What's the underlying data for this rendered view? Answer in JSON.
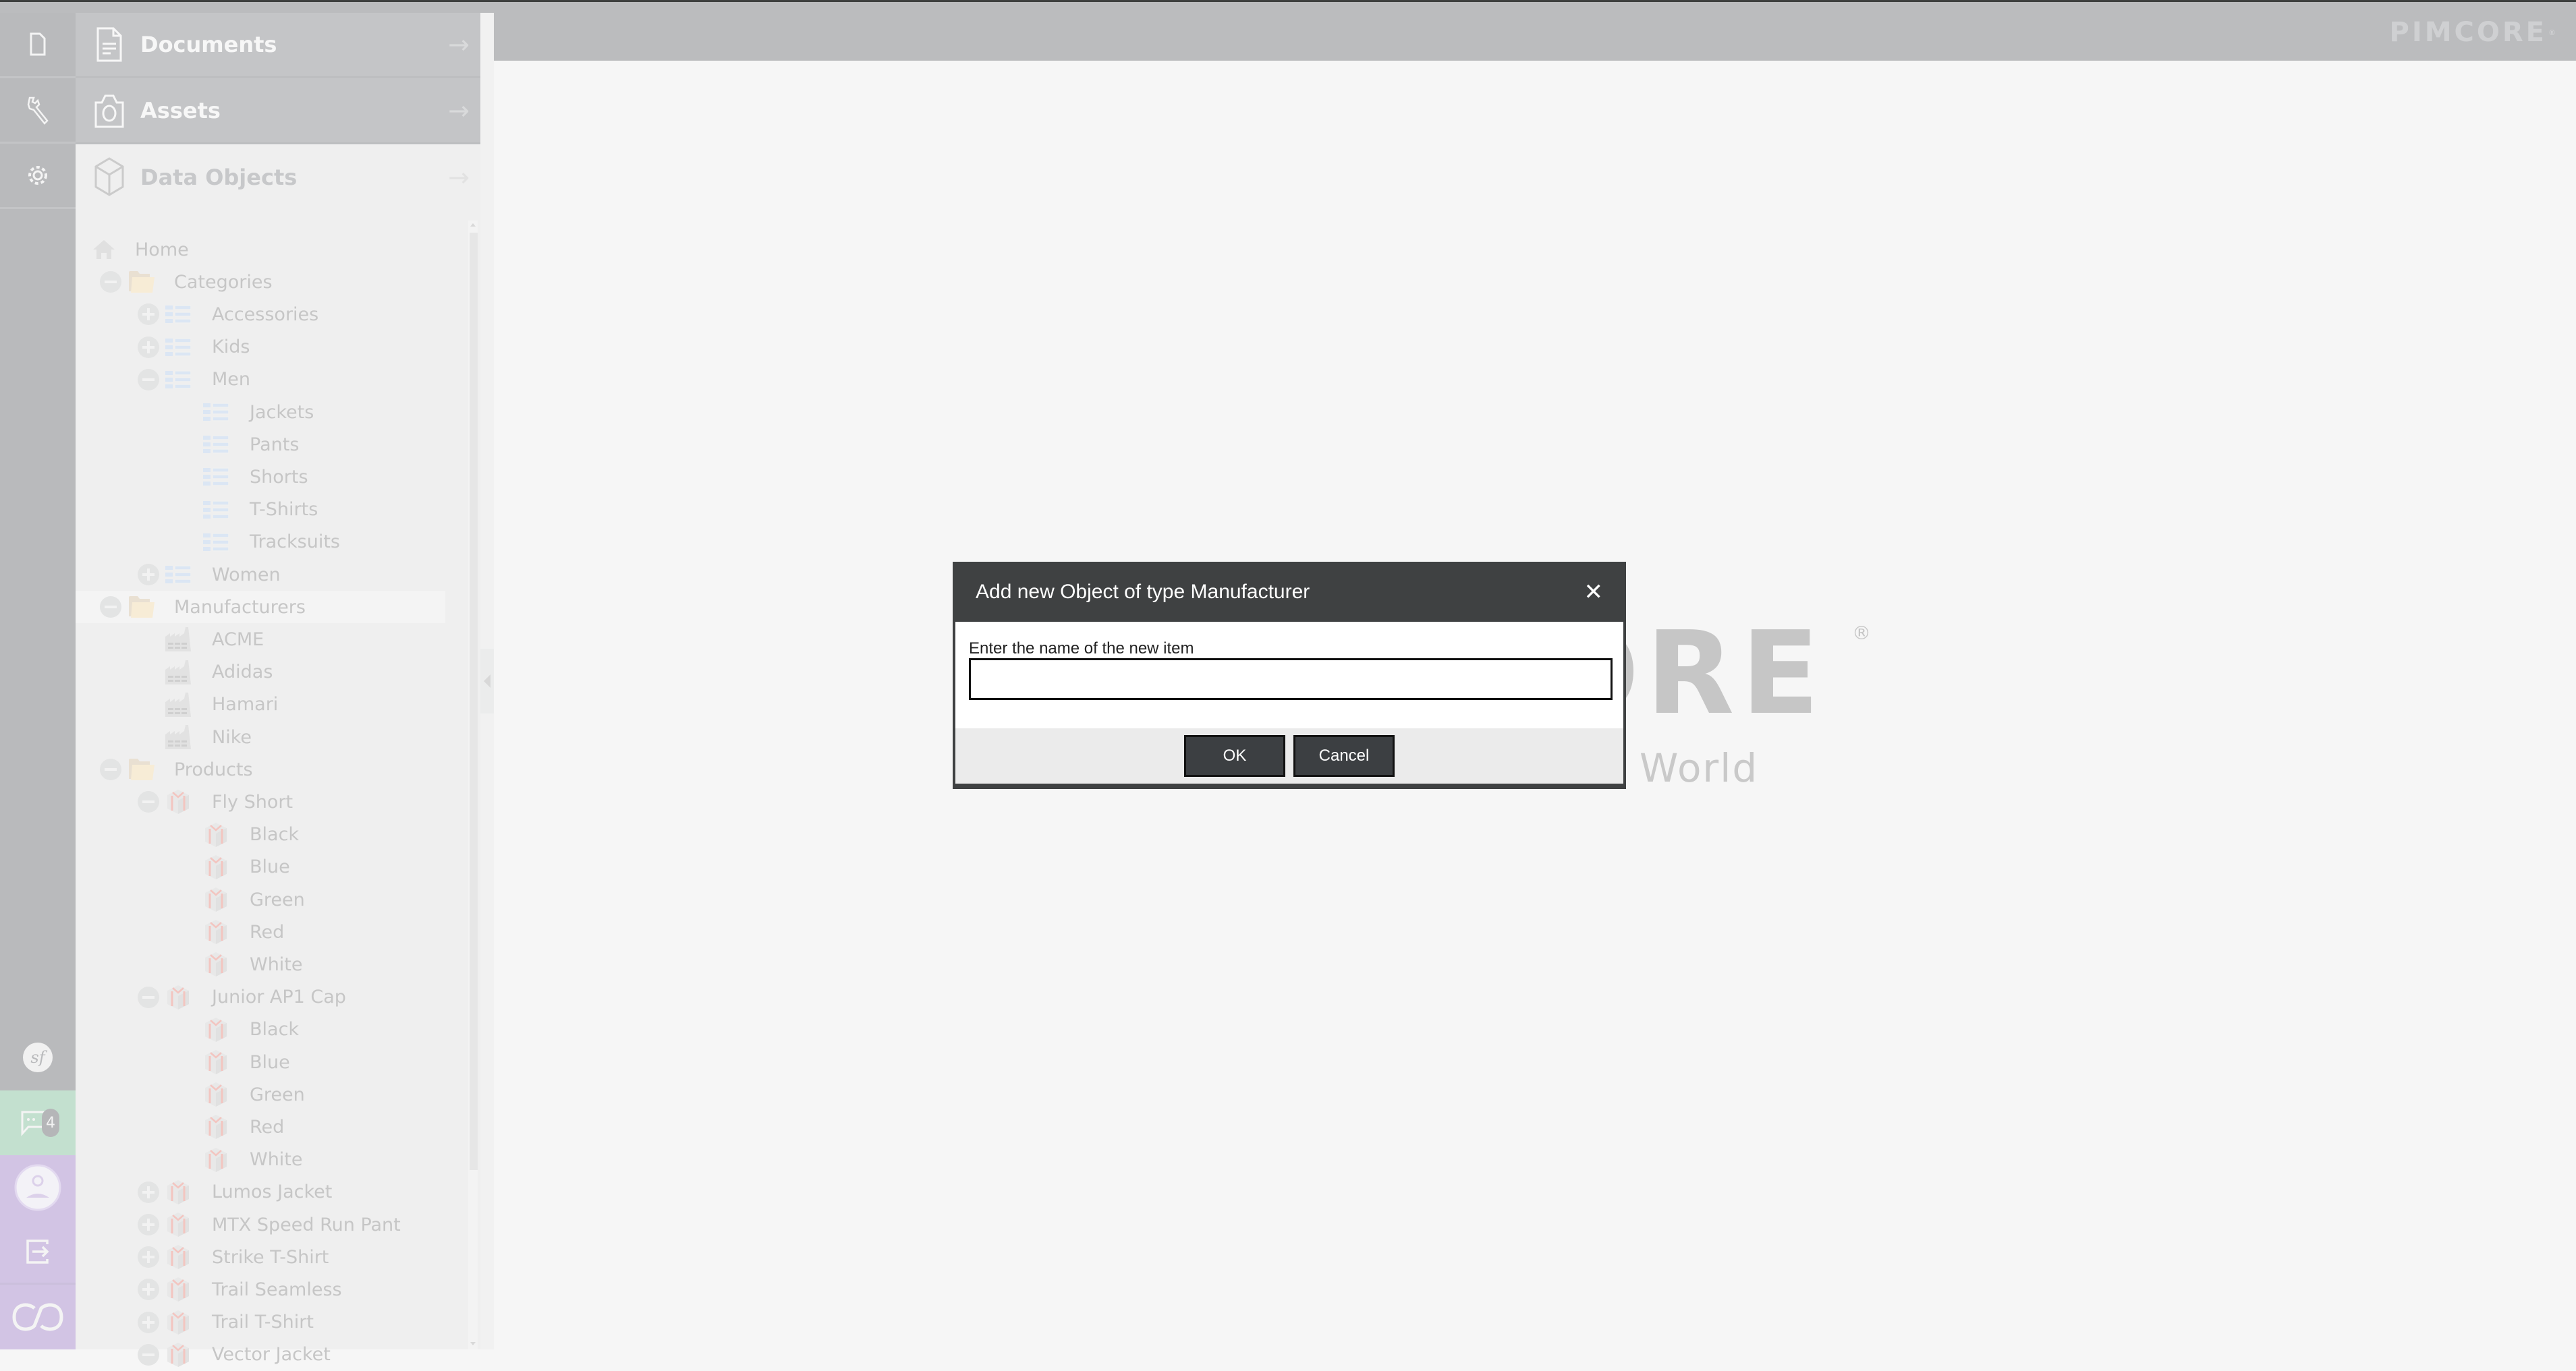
{
  "header": {
    "logo_text": "PIMCORE",
    "logo_reg": "®"
  },
  "toolbar": {
    "top_items": [
      {
        "name": "file-icon",
        "label": "File"
      },
      {
        "name": "tools-icon",
        "label": "Tools"
      },
      {
        "name": "settings-icon",
        "label": "Settings"
      }
    ],
    "notifications_count": "4"
  },
  "nav": {
    "documents": "Documents",
    "assets": "Assets",
    "data_objects": "Data Objects"
  },
  "tree": [
    {
      "label": "Home",
      "level": 0,
      "icon": "home",
      "expander": "none"
    },
    {
      "label": "Categories",
      "level": 1,
      "icon": "folder",
      "expander": "minus"
    },
    {
      "label": "Accessories",
      "level": 2,
      "icon": "category",
      "expander": "plus"
    },
    {
      "label": "Kids",
      "level": 2,
      "icon": "category",
      "expander": "plus"
    },
    {
      "label": "Men",
      "level": 2,
      "icon": "category",
      "expander": "minus"
    },
    {
      "label": "Jackets",
      "level": 3,
      "icon": "category",
      "expander": "none"
    },
    {
      "label": "Pants",
      "level": 3,
      "icon": "category",
      "expander": "none"
    },
    {
      "label": "Shorts",
      "level": 3,
      "icon": "category",
      "expander": "none"
    },
    {
      "label": "T-Shirts",
      "level": 3,
      "icon": "category",
      "expander": "none"
    },
    {
      "label": "Tracksuits",
      "level": 3,
      "icon": "category",
      "expander": "none"
    },
    {
      "label": "Women",
      "level": 2,
      "icon": "category",
      "expander": "plus"
    },
    {
      "label": "Manufacturers",
      "level": 1,
      "icon": "folder",
      "expander": "minus",
      "selected": true
    },
    {
      "label": "ACME",
      "level": 2,
      "icon": "factory",
      "expander": "none"
    },
    {
      "label": "Adidas",
      "level": 2,
      "icon": "factory",
      "expander": "none"
    },
    {
      "label": "Hamari",
      "level": 2,
      "icon": "factory",
      "expander": "none"
    },
    {
      "label": "Nike",
      "level": 2,
      "icon": "factory",
      "expander": "none"
    },
    {
      "label": "Products",
      "level": 1,
      "icon": "folder",
      "expander": "minus"
    },
    {
      "label": "Fly Short",
      "level": 2,
      "icon": "product",
      "expander": "minus"
    },
    {
      "label": "Black",
      "level": 3,
      "icon": "product",
      "expander": "none"
    },
    {
      "label": "Blue",
      "level": 3,
      "icon": "product",
      "expander": "none"
    },
    {
      "label": "Green",
      "level": 3,
      "icon": "product",
      "expander": "none"
    },
    {
      "label": "Red",
      "level": 3,
      "icon": "product",
      "expander": "none"
    },
    {
      "label": "White",
      "level": 3,
      "icon": "product",
      "expander": "none"
    },
    {
      "label": "Junior AP1 Cap",
      "level": 2,
      "icon": "product",
      "expander": "minus"
    },
    {
      "label": "Black",
      "level": 3,
      "icon": "product",
      "expander": "none"
    },
    {
      "label": "Blue",
      "level": 3,
      "icon": "product",
      "expander": "none"
    },
    {
      "label": "Green",
      "level": 3,
      "icon": "product",
      "expander": "none"
    },
    {
      "label": "Red",
      "level": 3,
      "icon": "product",
      "expander": "none"
    },
    {
      "label": "White",
      "level": 3,
      "icon": "product",
      "expander": "none"
    },
    {
      "label": "Lumos Jacket",
      "level": 2,
      "icon": "product",
      "expander": "plus"
    },
    {
      "label": "MTX Speed Run Pant",
      "level": 2,
      "icon": "product",
      "expander": "plus"
    },
    {
      "label": "Strike T-Shirt",
      "level": 2,
      "icon": "product",
      "expander": "plus"
    },
    {
      "label": "Trail Seamless",
      "level": 2,
      "icon": "product",
      "expander": "plus"
    },
    {
      "label": "Trail T-Shirt",
      "level": 2,
      "icon": "product",
      "expander": "plus"
    },
    {
      "label": "Vector Jacket",
      "level": 2,
      "icon": "product",
      "expander": "minus"
    }
  ],
  "background_logo": {
    "visible_text": "ORE",
    "reg": "®",
    "tagline_visible": "World"
  },
  "dialog": {
    "title": "Add new Object of type Manufacturer",
    "close_symbol": "✕",
    "field_label": "Enter the name of the new item",
    "field_value": "",
    "ok_label": "OK",
    "cancel_label": "Cancel"
  },
  "colors": {
    "toolbar_bg": "#b9babc",
    "header_bg": "#bbbcbe",
    "dialog_bg": "#3f4142",
    "notifications_bg": "#c3e0cf",
    "user_bg": "#d2c4e4"
  }
}
